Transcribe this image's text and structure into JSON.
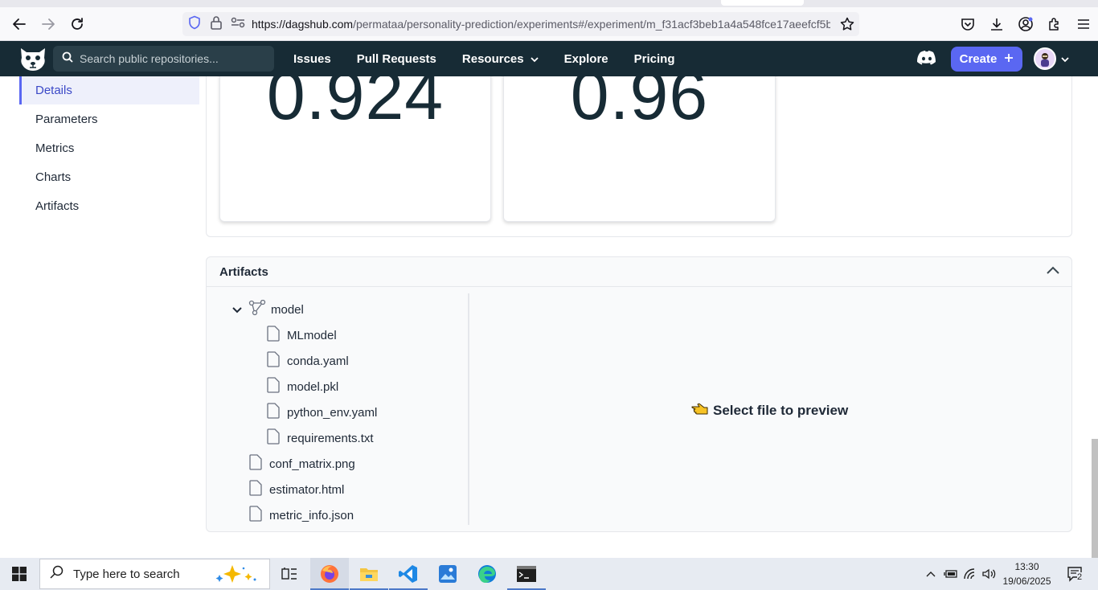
{
  "browser": {
    "url_host": "https://dagshub.com",
    "url_path": "/permataa/personality-prediction/experiments#/experiment/m_f31acf3beb1a4a548fce17aeefcf5b"
  },
  "header": {
    "search_placeholder": "Search public repositories...",
    "nav": [
      "Issues",
      "Pull Requests",
      "Resources",
      "Explore",
      "Pricing"
    ],
    "create_label": "Create",
    "brand_color": "#172b35",
    "accent_color": "#5a67f2"
  },
  "sidebar": {
    "items": [
      "Details",
      "Parameters",
      "Metrics",
      "Charts",
      "Artifacts"
    ],
    "active": "Details"
  },
  "metrics": {
    "values": [
      "0.924",
      "0.96"
    ]
  },
  "artifacts": {
    "title": "Artifacts",
    "folder": "model",
    "folder_files": [
      "MLmodel",
      "conda.yaml",
      "model.pkl",
      "python_env.yaml",
      "requirements.txt"
    ],
    "root_files": [
      "conf_matrix.png",
      "estimator.html",
      "metric_info.json"
    ],
    "preview_text": "Select file to preview",
    "preview_icon": "pointing-hand-icon"
  },
  "taskbar": {
    "search_placeholder": "Type here to search",
    "time": "13:30",
    "date": "19/06/2025",
    "notification_count": "2"
  }
}
